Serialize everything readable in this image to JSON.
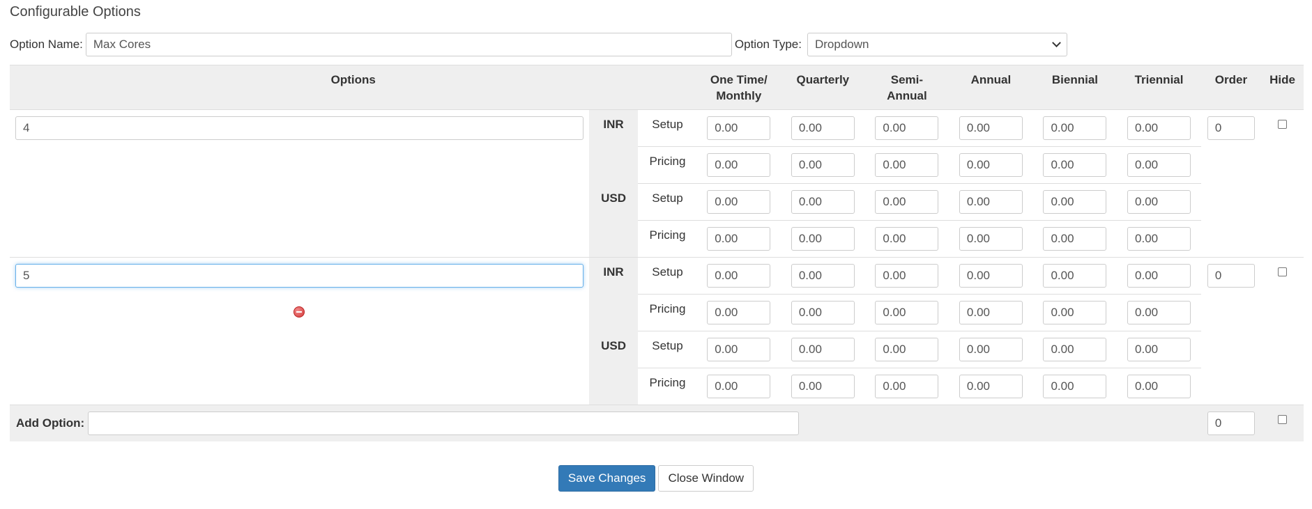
{
  "title": "Configurable Options",
  "option_name": {
    "label": "Option Name:",
    "value": "Max Cores"
  },
  "option_type": {
    "label": "Option Type:",
    "value": "Dropdown"
  },
  "columns": {
    "options": "Options",
    "one_time_l1": "One Time/",
    "one_time_l2": "Monthly",
    "quarterly": "Quarterly",
    "semi_l1": "Semi-",
    "semi_l2": "Annual",
    "annual": "Annual",
    "biennial": "Biennial",
    "triennial": "Triennial",
    "order": "Order",
    "hide": "Hide"
  },
  "row_labels": {
    "setup": "Setup",
    "pricing": "Pricing"
  },
  "currencies": [
    "INR",
    "USD"
  ],
  "option_rows": [
    {
      "value": "4",
      "order": "0",
      "hidden": false,
      "has_remove": false,
      "prices": {
        "INR": {
          "setup": [
            "0.00",
            "0.00",
            "0.00",
            "0.00",
            "0.00",
            "0.00"
          ],
          "pricing": [
            "0.00",
            "0.00",
            "0.00",
            "0.00",
            "0.00",
            "0.00"
          ]
        },
        "USD": {
          "setup": [
            "0.00",
            "0.00",
            "0.00",
            "0.00",
            "0.00",
            "0.00"
          ],
          "pricing": [
            "0.00",
            "0.00",
            "0.00",
            "0.00",
            "0.00",
            "0.00"
          ]
        }
      }
    },
    {
      "value": "5",
      "order": "0",
      "hidden": false,
      "has_remove": true,
      "focused": true,
      "prices": {
        "INR": {
          "setup": [
            "0.00",
            "0.00",
            "0.00",
            "0.00",
            "0.00",
            "0.00"
          ],
          "pricing": [
            "0.00",
            "0.00",
            "0.00",
            "0.00",
            "0.00",
            "0.00"
          ]
        },
        "USD": {
          "setup": [
            "0.00",
            "0.00",
            "0.00",
            "0.00",
            "0.00",
            "0.00"
          ],
          "pricing": [
            "0.00",
            "0.00",
            "0.00",
            "0.00",
            "0.00",
            "0.00"
          ]
        }
      }
    }
  ],
  "add_option": {
    "label": "Add Option:",
    "value": "",
    "order": "0",
    "hidden": false
  },
  "buttons": {
    "save": "Save Changes",
    "close": "Close Window"
  }
}
